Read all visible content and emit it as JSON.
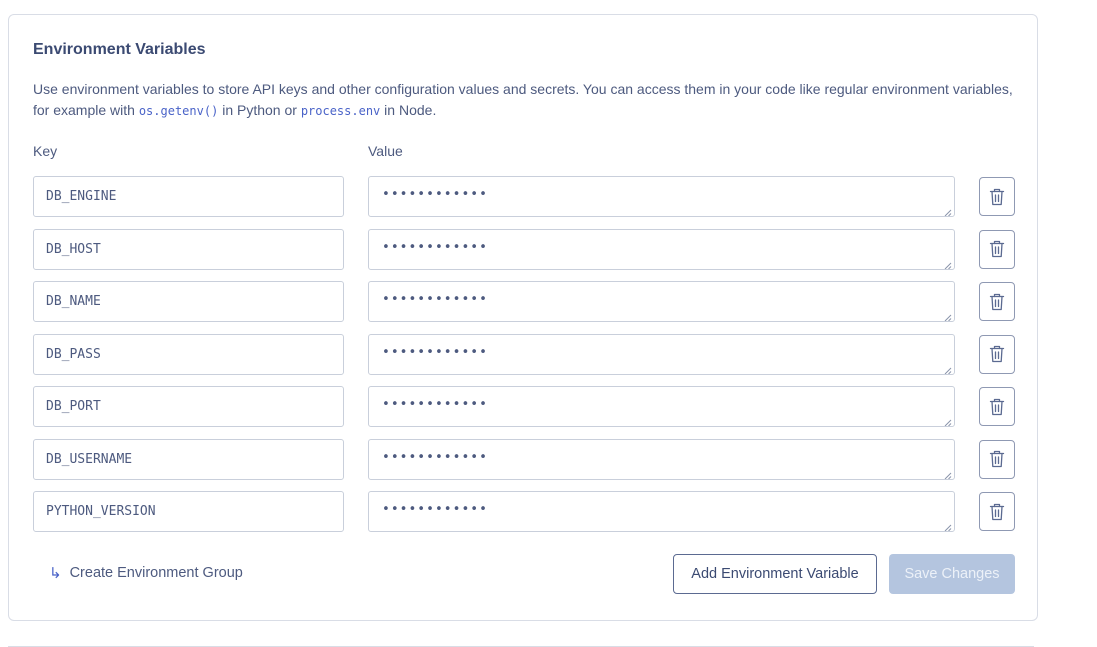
{
  "section": {
    "title": "Environment Variables",
    "description_before": "Use environment variables to store API keys and other configuration values and secrets. You can access them in your code like regular environment variables, for example with ",
    "code_python": "os.getenv()",
    "description_middle": " in Python or ",
    "code_node": "process.env",
    "description_after": " in Node."
  },
  "columns": {
    "key_label": "Key",
    "value_label": "Value"
  },
  "variables": [
    {
      "key": "DB_ENGINE",
      "value_masked": "••••••••••••"
    },
    {
      "key": "DB_HOST",
      "value_masked": "••••••••••••"
    },
    {
      "key": "DB_NAME",
      "value_masked": "••••••••••••"
    },
    {
      "key": "DB_PASS",
      "value_masked": "••••••••••••"
    },
    {
      "key": "DB_PORT",
      "value_masked": "••••••••••••"
    },
    {
      "key": "DB_USERNAME",
      "value_masked": "••••••••••••"
    },
    {
      "key": "PYTHON_VERSION",
      "value_masked": "••••••••••••"
    }
  ],
  "icons": {
    "delete": "trash-icon",
    "group_link": "return-arrow-icon"
  },
  "footer": {
    "group_link_arrow": "↳",
    "group_link_label": "Create Environment Group",
    "add_button_label": "Add Environment Variable",
    "save_button_label": "Save Changes"
  },
  "colors": {
    "accent": "#4a63c8",
    "text": "#4d5a7f",
    "border": "#c9cfdb",
    "save_disabled_bg": "#b4c5df"
  }
}
